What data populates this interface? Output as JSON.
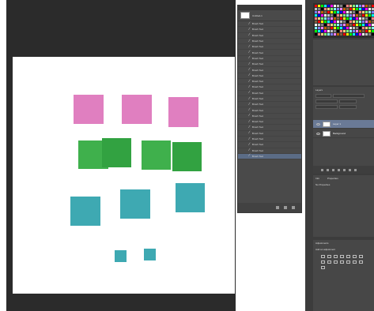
{
  "history": {
    "snapshot_label": "Untitled-1",
    "steps": [
      "Brush Tool",
      "Brush Tool",
      "Brush Tool",
      "Brush Tool",
      "Brush Tool",
      "Brush Tool",
      "Brush Tool",
      "Brush Tool",
      "Brush Tool",
      "Brush Tool",
      "Brush Tool",
      "Brush Tool",
      "Brush Tool",
      "Brush Tool",
      "Brush Tool",
      "Brush Tool",
      "Brush Tool",
      "Brush Tool",
      "Brush Tool",
      "Brush Tool",
      "Brush Tool",
      "Brush Tool",
      "Brush Tool",
      "Brush Tool"
    ],
    "selected_index": 23
  },
  "layers": {
    "tab": "Layers",
    "rows": [
      "Layer 1",
      "Background"
    ],
    "selected_index": 0
  },
  "properties": {
    "tab_a": "Info",
    "tab_b": "Properties",
    "status": "No Properties"
  },
  "adjustments": {
    "tab": "Adjustments",
    "subtitle": "Add an adjustment"
  },
  "colors": {
    "pink": "#e07fc0",
    "green": "#3fb04c",
    "teal": "#3ea9b2",
    "selection": "#5b6c86"
  }
}
